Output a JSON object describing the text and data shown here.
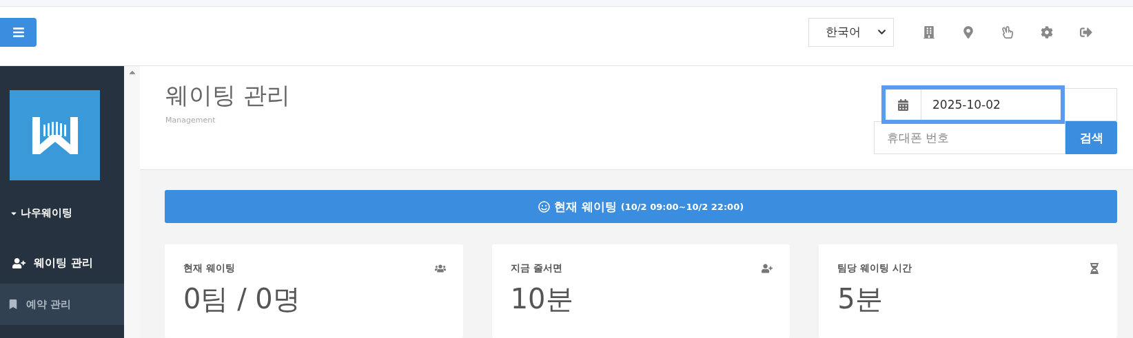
{
  "header": {
    "language": "한국어"
  },
  "sidebar": {
    "section": {
      "label": "나우웨이팅",
      "expanded": true
    },
    "items": [
      {
        "label": "웨이팅 관리",
        "selected": true
      },
      {
        "label": "예약 관리",
        "selected": false
      }
    ]
  },
  "page": {
    "title": "웨이팅 관리",
    "subtitle": "Management"
  },
  "filters": {
    "date": {
      "value": "2025-10-02",
      "focused": true
    },
    "phone": {
      "placeholder": "휴대폰 번호"
    },
    "search_button": "검색"
  },
  "banner": {
    "title": "현재 웨이팅",
    "range": "(10/2 09:00~10/2 22:00)"
  },
  "stats": [
    {
      "label": "현재 웨이팅",
      "value": "0팀 / 0명"
    },
    {
      "label": "지금 줄서면",
      "value": "10분"
    },
    {
      "label": "팀당 웨이팅 시간",
      "value": "5분"
    }
  ]
}
